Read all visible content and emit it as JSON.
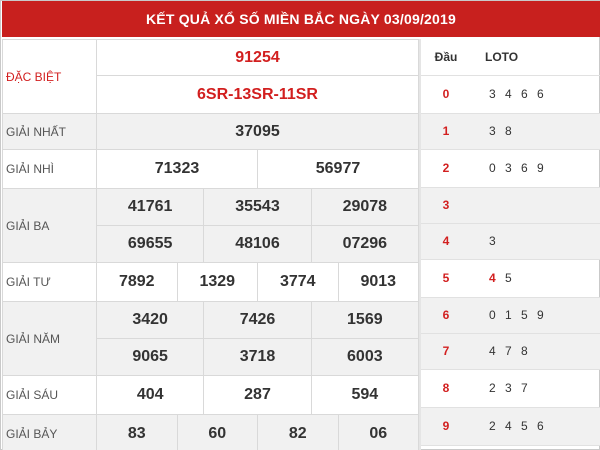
{
  "title": "KẾT QUẢ XỔ SỐ MIỀN BẮC NGÀY 03/09/2019",
  "prizes": {
    "special": {
      "label": "ĐẶC BIỆT",
      "number": "91254",
      "code": "6SR-13SR-11SR"
    },
    "first": {
      "label": "GIẢI NHẤT",
      "numbers": [
        "37095"
      ]
    },
    "second": {
      "label": "GIẢI NHÌ",
      "numbers": [
        "71323",
        "56977"
      ]
    },
    "third": {
      "label": "GIẢI BA",
      "numbers": [
        "41761",
        "35543",
        "29078",
        "69655",
        "48106",
        "07296"
      ]
    },
    "fourth": {
      "label": "GIẢI TƯ",
      "numbers": [
        "7892",
        "1329",
        "3774",
        "9013"
      ]
    },
    "fifth": {
      "label": "GIẢI NĂM",
      "numbers": [
        "3420",
        "7426",
        "1569",
        "9065",
        "3718",
        "6003"
      ]
    },
    "sixth": {
      "label": "GIẢI SÁU",
      "numbers": [
        "404",
        "287",
        "594"
      ]
    },
    "seventh": {
      "label": "GIẢI BẢY",
      "numbers": [
        "83",
        "60",
        "82",
        "06"
      ]
    }
  },
  "loto": {
    "head_dau": "Đầu",
    "head_loto": "LOTO",
    "rows": [
      {
        "dau": "0",
        "values": "3 4 6 6"
      },
      {
        "dau": "1",
        "values": "3 8"
      },
      {
        "dau": "2",
        "values": "0 3 6 9"
      },
      {
        "dau": "3",
        "values": ""
      },
      {
        "dau": "4",
        "values": "3"
      },
      {
        "dau": "5",
        "values": "4 5"
      },
      {
        "dau": "6",
        "values": "0 1 5 9"
      },
      {
        "dau": "7",
        "values": "4 7 8"
      },
      {
        "dau": "8",
        "values": "2 3 7"
      },
      {
        "dau": "9",
        "values": "2 4 5 6"
      }
    ]
  },
  "colors": {
    "header_bg": "#c8201e",
    "accent_red": "#d21f1f",
    "shade": "#f1f1f1"
  }
}
